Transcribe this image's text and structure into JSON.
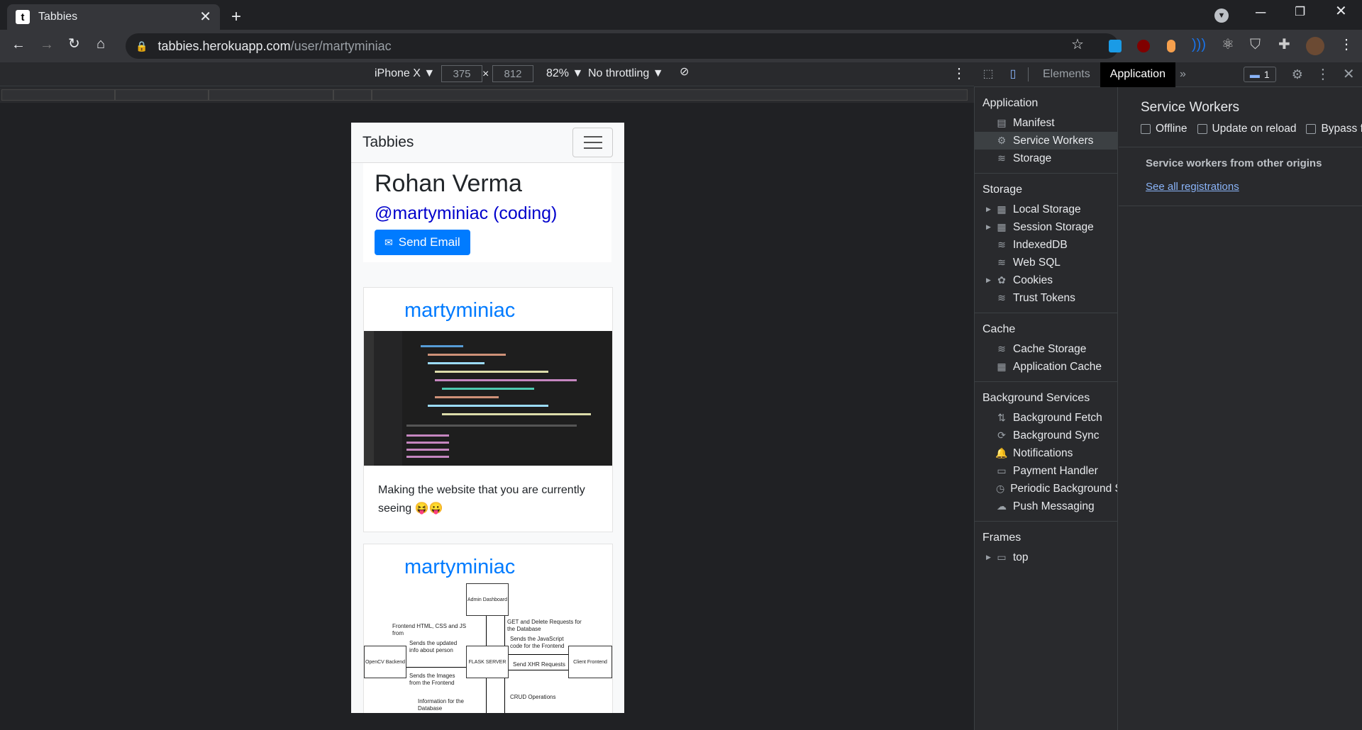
{
  "browser": {
    "tab_title": "Tabbies",
    "favicon_letter": "t",
    "url_host": "tabbies.herokuapp.com",
    "url_path": "/user/martyminiac"
  },
  "device_toolbar": {
    "device": "iPhone X ▼",
    "width": "375",
    "times": "×",
    "height": "812",
    "zoom": "82% ▼",
    "throttling": "No throttling ▼"
  },
  "site": {
    "brand": "Tabbies",
    "profile": {
      "name": "Rohan Verma",
      "handle": "@martyminiac (coding)",
      "email_button": "Send Email"
    },
    "posts": [
      {
        "user": "martyminiac",
        "text": "Making the website that you are currently seeing 😝😛"
      },
      {
        "user": "martyminiac"
      }
    ],
    "diagram": {
      "admin": "Admin Dashboard",
      "server": "FLASK SERVER",
      "opencv": "OpenCV Backend",
      "client": "Client Frontend",
      "l1": "Frontend HTML, CSS and JS from",
      "l2": "GET and Delete Requests for the Database",
      "l3": "Sends the updated info about person",
      "l4": "Sends the JavaScript code for the Frontend",
      "l5": "Send XHR Requests",
      "l6": "Sends the Images from the Frontend",
      "l7": "CRUD Operations",
      "l8": "Information for the Database"
    }
  },
  "devtools": {
    "tabs": [
      "Elements",
      "Application"
    ],
    "more": "»",
    "issues_count": "1",
    "sidebar": {
      "application_header": "Application",
      "application_items": [
        "Manifest",
        "Service Workers",
        "Storage"
      ],
      "storage_header": "Storage",
      "storage_items": [
        "Local Storage",
        "Session Storage",
        "IndexedDB",
        "Web SQL",
        "Cookies",
        "Trust Tokens"
      ],
      "cache_header": "Cache",
      "cache_items": [
        "Cache Storage",
        "Application Cache"
      ],
      "bg_header": "Background Services",
      "bg_items": [
        "Background Fetch",
        "Background Sync",
        "Notifications",
        "Payment Handler",
        "Periodic Background S",
        "Push Messaging"
      ],
      "frames_header": "Frames",
      "frames_items": [
        "top"
      ]
    },
    "main": {
      "title": "Service Workers",
      "options": [
        "Offline",
        "Update on reload",
        "Bypass fo"
      ],
      "other_origins": "Service workers from other origins",
      "see_all": "See all registrations"
    }
  }
}
